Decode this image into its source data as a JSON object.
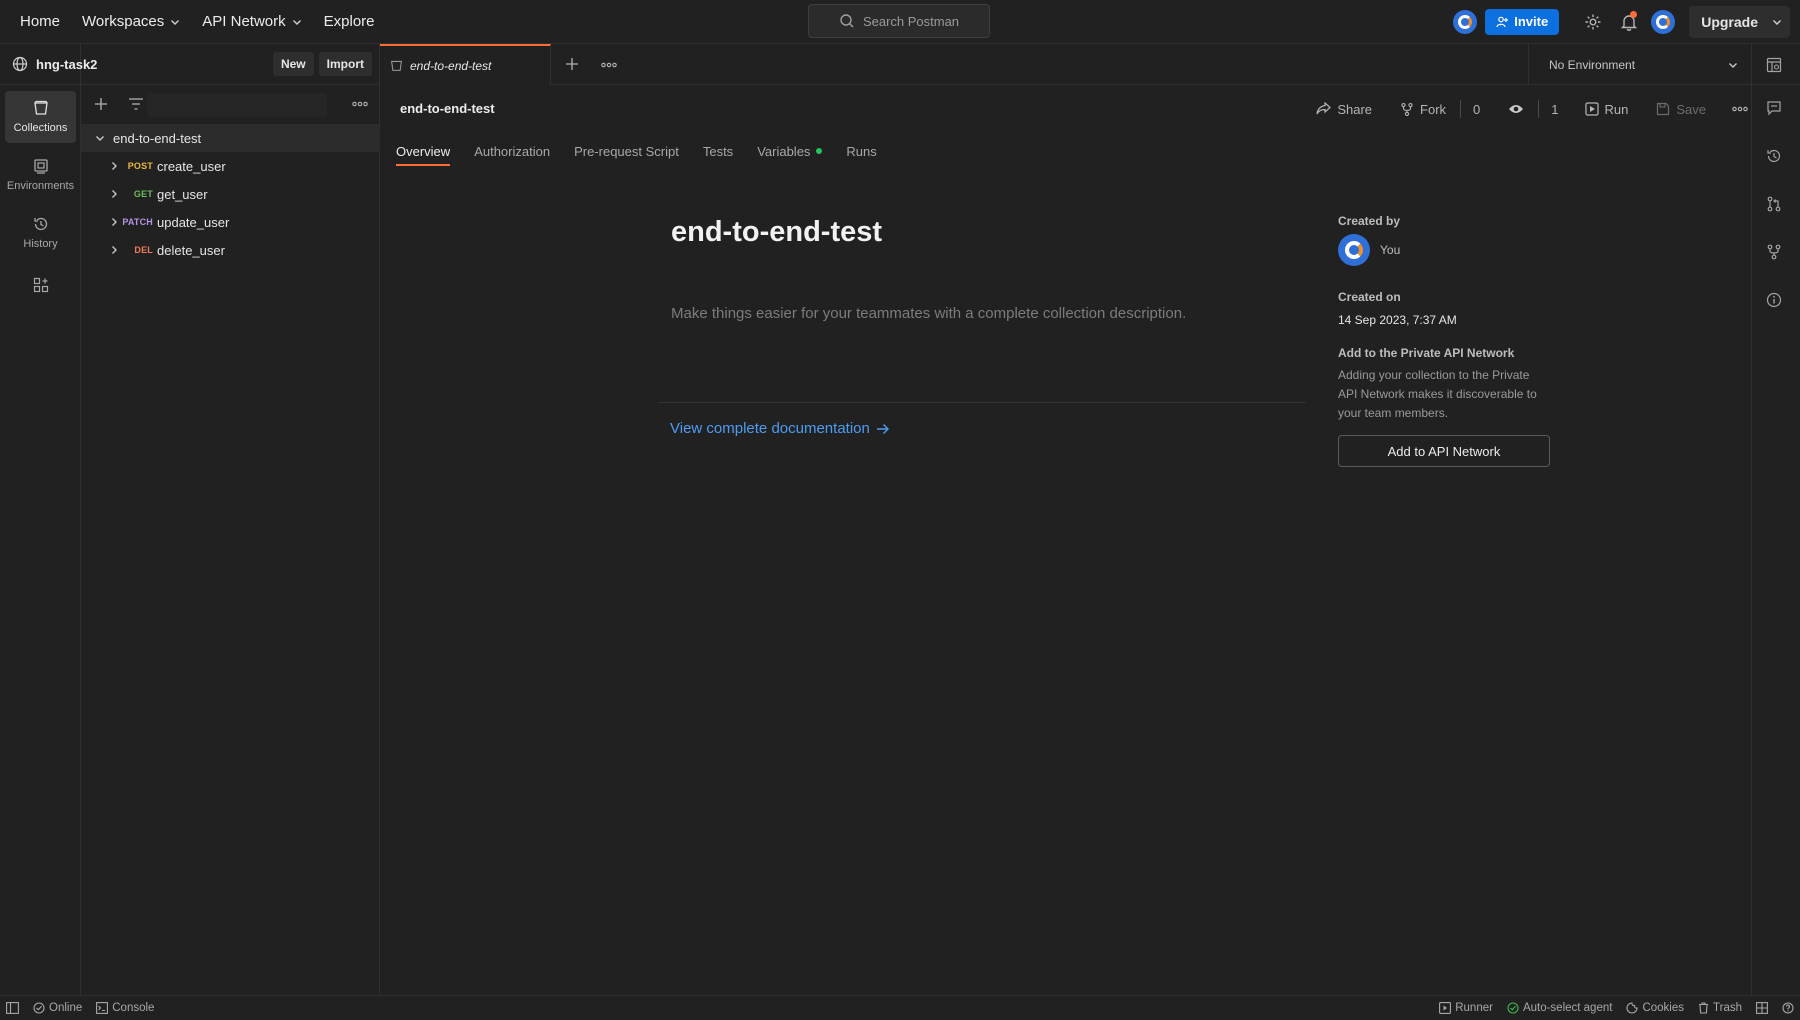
{
  "topbar": {
    "nav": [
      "Home",
      "Workspaces",
      "API Network",
      "Explore"
    ],
    "search_placeholder": "Search Postman",
    "invite_label": "Invite",
    "upgrade_label": "Upgrade"
  },
  "workspace": {
    "name": "hng-task2",
    "new_label": "New",
    "import_label": "Import"
  },
  "rail": {
    "items": [
      {
        "label": "Collections",
        "icon": "collections-icon",
        "active": true
      },
      {
        "label": "Environments",
        "icon": "environments-icon"
      },
      {
        "label": "History",
        "icon": "history-icon"
      }
    ]
  },
  "tree": {
    "collection": "end-to-end-test",
    "requests": [
      {
        "method": "POST",
        "name": "create_user",
        "color": "#e8b93a"
      },
      {
        "method": "GET",
        "name": "get_user",
        "color": "#6bbd5b"
      },
      {
        "method": "PATCH",
        "name": "update_user",
        "color": "#b693e8"
      },
      {
        "method": "DEL",
        "name": "delete_user",
        "color": "#f0795a"
      }
    ]
  },
  "tab": {
    "label": "end-to-end-test"
  },
  "environment": {
    "selected": "No Environment"
  },
  "main": {
    "title": "end-to-end-test",
    "actions": {
      "share": "Share",
      "fork": "Fork",
      "fork_count": "0",
      "watch_count": "1",
      "run": "Run",
      "save": "Save"
    },
    "subtabs": [
      "Overview",
      "Authorization",
      "Pre-request Script",
      "Tests",
      "Variables",
      "Runs"
    ]
  },
  "overview": {
    "title": "end-to-end-test",
    "description": "Make things easier for your teammates with a complete collection description.",
    "doc_link": "View complete documentation",
    "created_by_label": "Created by",
    "created_by": "You",
    "created_on_label": "Created on",
    "created_on": "14 Sep 2023, 7:37 AM",
    "network_label": "Add to the Private API Network",
    "network_text_1": "Adding your collection to the Private",
    "network_text_2": "API Network makes it discoverable to",
    "network_text_3": "your team members.",
    "network_button": "Add to API Network"
  },
  "statusbar": {
    "online": "Online",
    "console": "Console",
    "runner": "Runner",
    "agent": "Auto-select agent",
    "cookies": "Cookies",
    "trash": "Trash"
  },
  "colors": {
    "accent": "#ff6c37",
    "invite": "#0c70e0",
    "link": "#4d9cf3",
    "variables_dot": "#22c55e"
  }
}
